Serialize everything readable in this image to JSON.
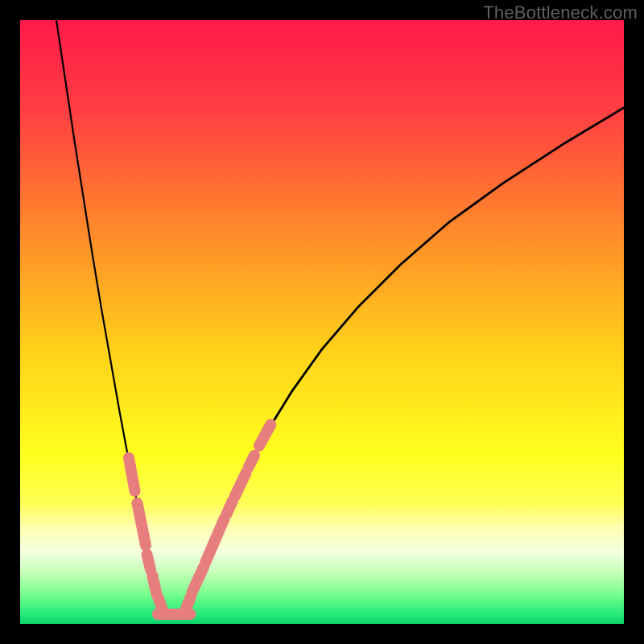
{
  "watermark": "TheBottleneck.com",
  "chart_data": {
    "type": "line",
    "title": "",
    "xlabel": "",
    "ylabel": "",
    "xlim": [
      0,
      100
    ],
    "ylim": [
      0,
      100
    ],
    "gradient_stops": [
      {
        "offset": 0.0,
        "color": "#ff1a4a"
      },
      {
        "offset": 0.15,
        "color": "#ff3e43"
      },
      {
        "offset": 0.35,
        "color": "#ff8a2a"
      },
      {
        "offset": 0.55,
        "color": "#ffd21a"
      },
      {
        "offset": 0.72,
        "color": "#ffff1e"
      },
      {
        "offset": 0.8,
        "color": "#ffff55"
      },
      {
        "offset": 0.84,
        "color": "#ffffb0"
      },
      {
        "offset": 0.88,
        "color": "#f4ffe0"
      },
      {
        "offset": 0.915,
        "color": "#c6ffb8"
      },
      {
        "offset": 0.95,
        "color": "#7aff8e"
      },
      {
        "offset": 0.985,
        "color": "#22e87a"
      },
      {
        "offset": 1.0,
        "color": "#0dd46a"
      }
    ],
    "series": [
      {
        "name": "left-curve",
        "stroke": "#000000",
        "x": [
          6.0,
          7.5,
          9.0,
          10.5,
          12.0,
          13.5,
          15.0,
          16.5,
          18.0,
          19.5,
          21.0,
          22.0,
          22.8,
          23.3,
          23.8
        ],
        "y": [
          100.0,
          90.0,
          80.0,
          70.5,
          61.0,
          52.0,
          43.5,
          35.0,
          27.0,
          19.5,
          12.5,
          8.0,
          5.0,
          3.3,
          2.2
        ]
      },
      {
        "name": "right-curve",
        "stroke": "#000000",
        "x": [
          27.5,
          28.5,
          30.0,
          32.0,
          34.5,
          37.5,
          41.0,
          45.0,
          50.0,
          56.0,
          63.0,
          71.0,
          80.0,
          90.0,
          100.0
        ],
        "y": [
          2.2,
          4.0,
          7.5,
          12.8,
          18.8,
          25.3,
          32.0,
          38.5,
          45.5,
          52.5,
          59.5,
          66.5,
          73.0,
          79.5,
          85.5
        ]
      },
      {
        "name": "flat-bottom",
        "stroke": "#e77e7e",
        "x": [
          22.8,
          28.2
        ],
        "y": [
          1.6,
          1.6
        ]
      }
    ],
    "bead_groups": [
      {
        "side": "left",
        "color": "#e77e7e",
        "segments": [
          {
            "x1": 18.0,
            "y1": 27.5,
            "x2": 19.0,
            "y2": 22.0
          },
          {
            "x1": 19.4,
            "y1": 20.0,
            "x2": 20.8,
            "y2": 13.0
          },
          {
            "x1": 21.0,
            "y1": 11.5,
            "x2": 21.6,
            "y2": 9.0
          },
          {
            "x1": 21.9,
            "y1": 8.0,
            "x2": 22.6,
            "y2": 5.0
          },
          {
            "x1": 22.8,
            "y1": 4.5,
            "x2": 23.5,
            "y2": 2.6
          }
        ]
      },
      {
        "side": "right",
        "color": "#e77e7e",
        "segments": [
          {
            "x1": 27.5,
            "y1": 2.6,
            "x2": 28.3,
            "y2": 4.6
          },
          {
            "x1": 28.5,
            "y1": 5.3,
            "x2": 30.4,
            "y2": 9.4
          },
          {
            "x1": 30.7,
            "y1": 10.2,
            "x2": 33.8,
            "y2": 17.4
          },
          {
            "x1": 34.2,
            "y1": 18.2,
            "x2": 35.2,
            "y2": 20.4
          },
          {
            "x1": 35.6,
            "y1": 21.2,
            "x2": 37.4,
            "y2": 25.0
          },
          {
            "x1": 37.8,
            "y1": 25.9,
            "x2": 38.8,
            "y2": 27.9
          },
          {
            "x1": 39.6,
            "y1": 29.5,
            "x2": 41.5,
            "y2": 33.0
          }
        ]
      }
    ]
  }
}
